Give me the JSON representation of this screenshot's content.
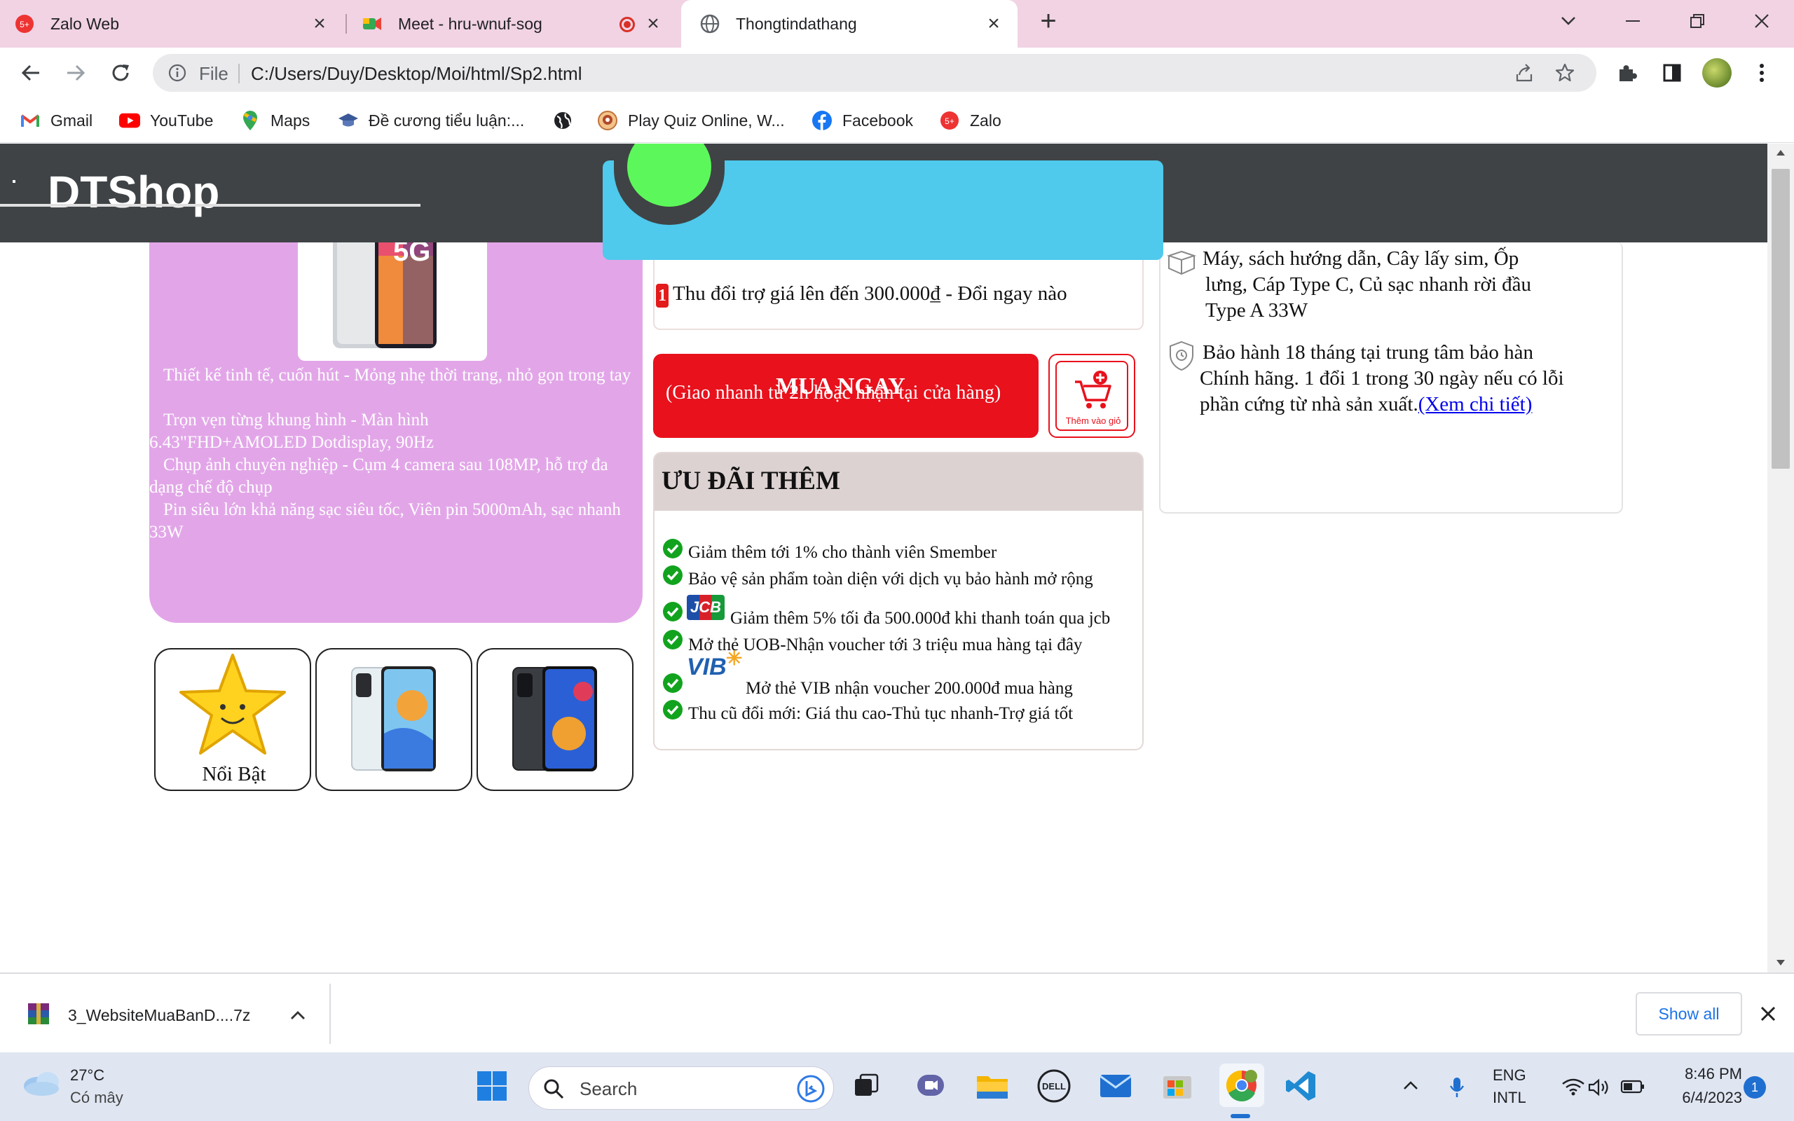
{
  "tabs": [
    {
      "title": "Zalo Web",
      "icon": "zalo-icon",
      "badge": "5+"
    },
    {
      "title": "Meet - hru-wnuf-sog",
      "icon": "meet-icon"
    },
    {
      "title": "Thongtindathang",
      "icon": "globe-icon"
    }
  ],
  "address": {
    "scheme": "File",
    "url": "C:/Users/Duy/Desktop/Moi/html/Sp2.html"
  },
  "bookmarks": [
    {
      "label": "Gmail",
      "icon": "gmail-icon"
    },
    {
      "label": "YouTube",
      "icon": "youtube-icon"
    },
    {
      "label": "Maps",
      "icon": "maps-icon"
    },
    {
      "label": "Đề cương tiểu luận:...",
      "icon": "graduation-icon"
    },
    {
      "label": "",
      "icon": "globe-icon"
    },
    {
      "label": "Play Quiz Online, W...",
      "icon": "quiz-icon"
    },
    {
      "label": "Facebook",
      "icon": "facebook-icon"
    },
    {
      "label": "Zalo",
      "icon": "zalo-icon"
    }
  ],
  "site": {
    "logo": "DTShop"
  },
  "product": {
    "badge_5g": "5G",
    "features": [
      "Thiết kế tinh tế, cuốn hút - Mỏng nhẹ thời trang, nhỏ gọn trong tay",
      "Trọn vẹn từng khung hình - Màn hình 6.43\"FHD+AMOLED Dotdisplay, 90Hz",
      "Chụp ảnh chuyên nghiệp - Cụm 4 camera sau 108MP, hỗ trợ đa dạng chế độ chụp",
      "Pin siêu lớn khả năng sạc siêu tốc, Viên pin 5000mAh, sạc nhanh 33W"
    ],
    "thumbnails": [
      {
        "label": "Nổi Bật",
        "icon": "star-icon"
      },
      {
        "label": "",
        "icon": "phone-white"
      },
      {
        "label": "",
        "icon": "phone-black"
      }
    ]
  },
  "promo": {
    "badge": "1",
    "text": "Thu đổi trợ giá lên đến 300.000₫ - Đổi ngay nào"
  },
  "buy": {
    "title": "MUA NGAY",
    "subtitle": "(Giao nhanh từ 2h hoặc nhận tại cửa hàng)",
    "cart_label": "Thêm vào giỏ"
  },
  "offers": {
    "title": "ƯU ĐÃI THÊM",
    "jcb_logo": "JCB",
    "vib_logo": "VIB",
    "items": [
      "Giảm thêm tới 1% cho thành viên Smember",
      "Bảo vệ sản phẩm toàn diện với dịch vụ bảo hành mở rộng",
      "Giảm thêm 5% tối đa 500.000đ khi thanh toán qua jcb",
      "Mở thẻ UOB-Nhận voucher tới 3 triệu mua hàng tại đây",
      "Mở thẻ VIB nhận voucher 200.000đ mua hàng",
      "Thu cũ đổi mới: Giá thu cao-Thủ tục nhanh-Trợ giá tốt"
    ]
  },
  "info": {
    "box_line1": "Máy, sách hướng dẫn, Cây lấy sim, Ốp",
    "box_line2": "lưng, Cáp Type C, Củ sạc nhanh rời đầu",
    "box_line3": "Type A 33W",
    "warranty_line1": "Bảo hành 18 tháng tại trung tâm bảo hàn",
    "warranty_line2": "Chính hãng. 1 đổi 1 trong 30 ngày nếu có lỗi",
    "warranty_line3": "phần cứng từ nhà sản xuất.",
    "warranty_link": "(Xem chi tiết)"
  },
  "download": {
    "filename": "3_WebsiteMuaBanD....7z",
    "show_all": "Show all"
  },
  "taskbar": {
    "weather_temp": "27°C",
    "weather_desc": "Có mây",
    "search_placeholder": "Search",
    "lang1": "ENG",
    "lang2": "INTL",
    "time": "8:46 PM",
    "date": "6/4/2023",
    "notif": "1"
  },
  "colors": {
    "header": "#3f4345",
    "accent_blue": "#4fc9ec",
    "green_circle": "#5cf85b",
    "purple_panel": "#e2a6e8",
    "buy_red": "#e8111c",
    "tab_bar": "#f1d3e4"
  }
}
